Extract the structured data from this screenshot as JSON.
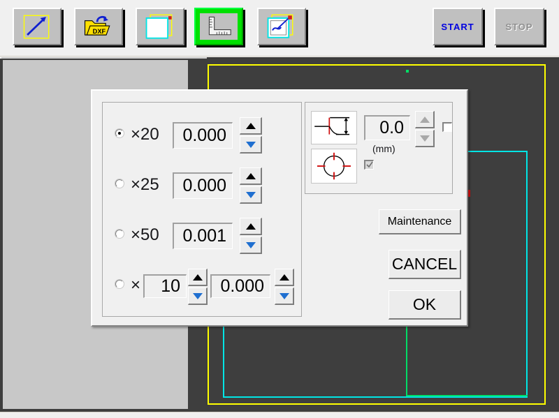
{
  "toolbar": {
    "buttons": [
      {
        "name": "draw-arrow-tool",
        "icon": "rect-arrow-icon",
        "selected": false,
        "tooltip": "Draw"
      },
      {
        "name": "open-dxf-tool",
        "icon": "folder-dxf-icon",
        "selected": false,
        "tooltip": "DXF"
      },
      {
        "name": "sheet-tool",
        "icon": "sheet-origin-icon",
        "selected": false,
        "tooltip": "Sheet"
      },
      {
        "name": "measure-tool",
        "icon": "ruler-icon",
        "selected": true,
        "tooltip": "Measure"
      },
      {
        "name": "path-tool",
        "icon": "path-arrow-icon",
        "selected": false,
        "tooltip": "Path"
      }
    ],
    "start_label": "START",
    "stop_label": "STOP",
    "start_enabled": true,
    "stop_enabled": false,
    "start_color": "#0000e0",
    "stop_color": "#909090"
  },
  "canvas": {
    "background_color": "#3e3e3e",
    "left_pane_color": "#c8c8c8",
    "shapes": [
      {
        "name": "sheet-outline-yellow",
        "color": "#ffff00"
      },
      {
        "name": "material-outline-cyan",
        "color": "#00e5e5"
      },
      {
        "name": "cut-path-green",
        "color": "#00dd66"
      },
      {
        "name": "marker-red",
        "color": "#e01010"
      }
    ]
  },
  "dialog": {
    "left_group": {
      "rows": [
        {
          "radio_label": "×20",
          "selected": true,
          "value": "0.000",
          "spinner": "updown-spinner"
        },
        {
          "radio_label": "×25",
          "selected": false,
          "value": "0.000",
          "spinner": "updown-spinner"
        },
        {
          "radio_label": "×50",
          "selected": false,
          "value": "0.001",
          "spinner": "updown-spinner"
        },
        {
          "radio_label": "×",
          "selected": false,
          "multiplier": "10",
          "value": "0.000",
          "spinner": "updown-spinner",
          "multiplier_spinner": "updown-spinner"
        }
      ]
    },
    "right_group": {
      "icon_corner": "corner-radius-icon",
      "icon_circle": "circle-crosshair-icon",
      "value": "0.0",
      "unit_label": "(mm)",
      "spinner_enabled": false,
      "checkbox_top": {
        "name": "offset-enable-checkbox",
        "checked": false,
        "enabled": true
      },
      "checkbox_bottom": {
        "name": "center-detect-checkbox",
        "checked": true,
        "enabled": false
      }
    },
    "buttons": {
      "maintenance": "Maintenance",
      "cancel": "CANCEL",
      "ok": "OK"
    }
  }
}
